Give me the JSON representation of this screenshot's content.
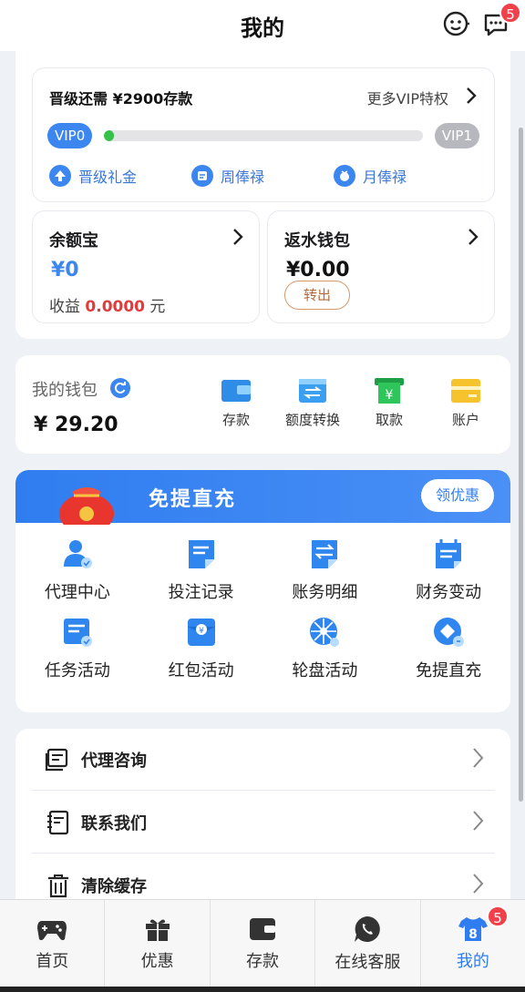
{
  "header": {
    "title": "我的",
    "message_badge": "5"
  },
  "vip": {
    "need_text": "晋级还需 ¥2900存款",
    "more_text": "更多VIP特权",
    "start_level": "VIP0",
    "end_level": "VIP1",
    "progress": 0.03,
    "bonuses": [
      {
        "label": "晋级礼金",
        "icon": "upgrade-icon"
      },
      {
        "label": "周俸禄",
        "icon": "weekly-icon"
      },
      {
        "label": "月俸禄",
        "icon": "monthly-icon"
      }
    ]
  },
  "yuebao": {
    "title": "余额宝",
    "amount": "¥0",
    "earn_label": "收益",
    "earn_value": "0.0000",
    "earn_unit": "元"
  },
  "rebate": {
    "title": "返水钱包",
    "amount": "¥0.00",
    "button": "转出"
  },
  "wallet": {
    "label": "我的钱包",
    "amount": "¥ 29.20",
    "actions": [
      {
        "label": "存款",
        "icon": "deposit-icon"
      },
      {
        "label": "额度转换",
        "icon": "transfer-icon"
      },
      {
        "label": "取款",
        "icon": "withdraw-icon"
      },
      {
        "label": "账户",
        "icon": "account-icon"
      }
    ]
  },
  "promo": {
    "title": "免提直充",
    "button": "领优惠",
    "items": [
      {
        "label": "代理中心",
        "icon": "agent-icon"
      },
      {
        "label": "投注记录",
        "icon": "bet-record-icon"
      },
      {
        "label": "账务明细",
        "icon": "account-detail-icon"
      },
      {
        "label": "财务变动",
        "icon": "finance-change-icon"
      },
      {
        "label": "任务活动",
        "icon": "task-icon"
      },
      {
        "label": "红包活动",
        "icon": "red-packet-icon"
      },
      {
        "label": "轮盘活动",
        "icon": "wheel-icon"
      },
      {
        "label": "免提直充",
        "icon": "direct-recharge-icon"
      }
    ]
  },
  "menu": [
    {
      "label": "代理咨询",
      "icon": "consult-icon"
    },
    {
      "label": "联系我们",
      "icon": "contact-icon"
    },
    {
      "label": "清除缓存",
      "icon": "trash-icon"
    }
  ],
  "nav": [
    {
      "label": "首页",
      "icon": "gamepad-icon"
    },
    {
      "label": "优惠",
      "icon": "gift-icon"
    },
    {
      "label": "存款",
      "icon": "wallet-icon"
    },
    {
      "label": "在线客服",
      "icon": "chat-icon"
    },
    {
      "label": "我的",
      "icon": "profile-icon",
      "badge": "5",
      "active": true
    }
  ],
  "colors": {
    "accent": "#2f7df0",
    "red": "#e23b3b",
    "progress": "#36c248"
  }
}
